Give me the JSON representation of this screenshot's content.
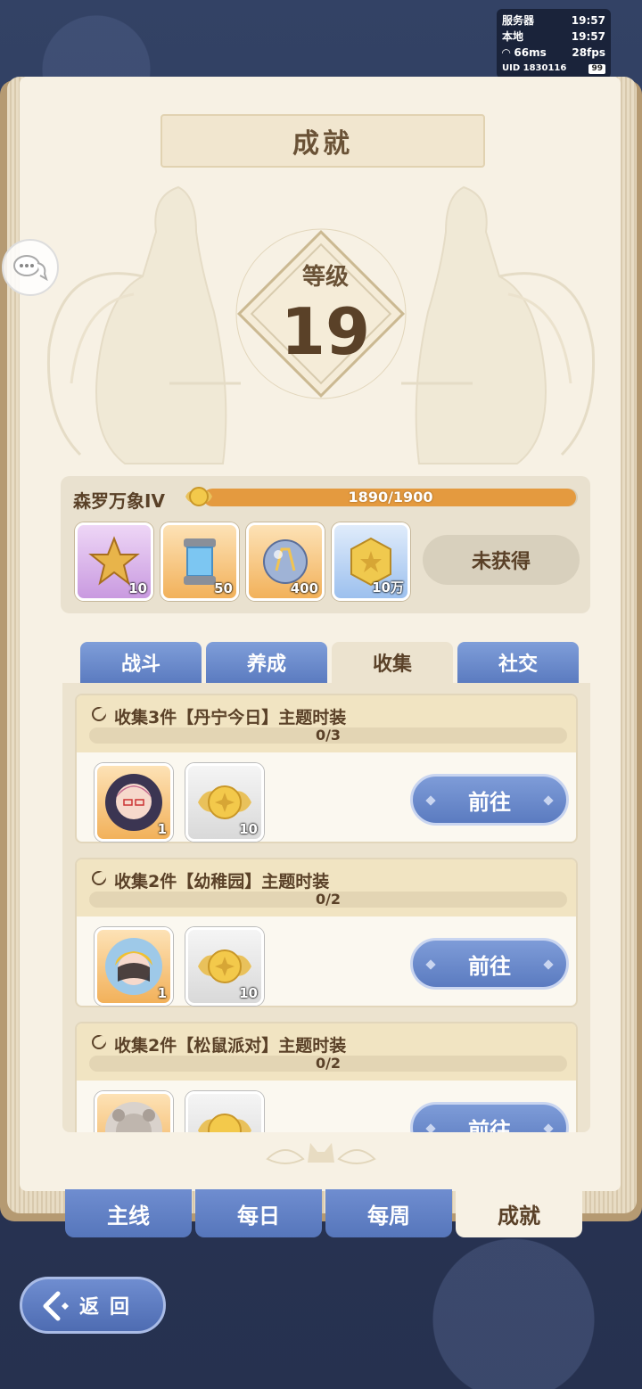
{
  "status": {
    "server_label": "服务器",
    "server_time": "19:57",
    "local_label": "本地",
    "local_time": "19:57",
    "ping": "66ms",
    "fps": "28fps",
    "uid": "UID 1830116",
    "battery": "99"
  },
  "header": {
    "title": "成就"
  },
  "level": {
    "label": "等级",
    "value": "19"
  },
  "rank": {
    "name": "森罗万象IV",
    "progress_text": "1890/1900",
    "progress_fraction": 0.9947,
    "rewards": [
      {
        "icon": "star-token-icon",
        "qty": "10",
        "rarity": "purple"
      },
      {
        "icon": "blue-canister-icon",
        "qty": "50",
        "rarity": "orange"
      },
      {
        "icon": "crystal-orb-icon",
        "qty": "400",
        "rarity": "orange"
      },
      {
        "icon": "gold-coin-icon",
        "qty": "10万",
        "rarity": "blue"
      }
    ],
    "status_button": "未获得"
  },
  "category_tabs": [
    {
      "label": "战斗",
      "active": false
    },
    {
      "label": "养成",
      "active": false
    },
    {
      "label": "收集",
      "active": true
    },
    {
      "label": "社交",
      "active": false
    }
  ],
  "achievements": [
    {
      "title": "收集3件【丹宁今日】主题时装",
      "progress_text": "0/3",
      "rewards": [
        {
          "icon": "character-costume-icon",
          "qty": "1"
        },
        {
          "icon": "winged-coin-icon",
          "qty": "10"
        }
      ],
      "button": "前往"
    },
    {
      "title": "收集2件【幼稚园】主题时装",
      "progress_text": "0/2",
      "rewards": [
        {
          "icon": "character-costume-icon",
          "qty": "1"
        },
        {
          "icon": "winged-coin-icon",
          "qty": "10"
        }
      ],
      "button": "前往"
    },
    {
      "title": "收集2件【松鼠派对】主题时装",
      "progress_text": "0/2",
      "rewards": [
        {
          "icon": "character-costume-icon",
          "qty": ""
        },
        {
          "icon": "winged-coin-icon",
          "qty": ""
        }
      ],
      "button": "前往"
    }
  ],
  "bottom_tabs": [
    {
      "label": "主线",
      "active": false
    },
    {
      "label": "每日",
      "active": false
    },
    {
      "label": "每周",
      "active": false
    },
    {
      "label": "成就",
      "active": true
    }
  ],
  "back_button": {
    "label": "返回"
  },
  "colors": {
    "accent_blue": "#5b7bc0",
    "progress_orange": "#e49a3f",
    "brown_text": "#5a4128",
    "paper": "#f7f1e4"
  }
}
